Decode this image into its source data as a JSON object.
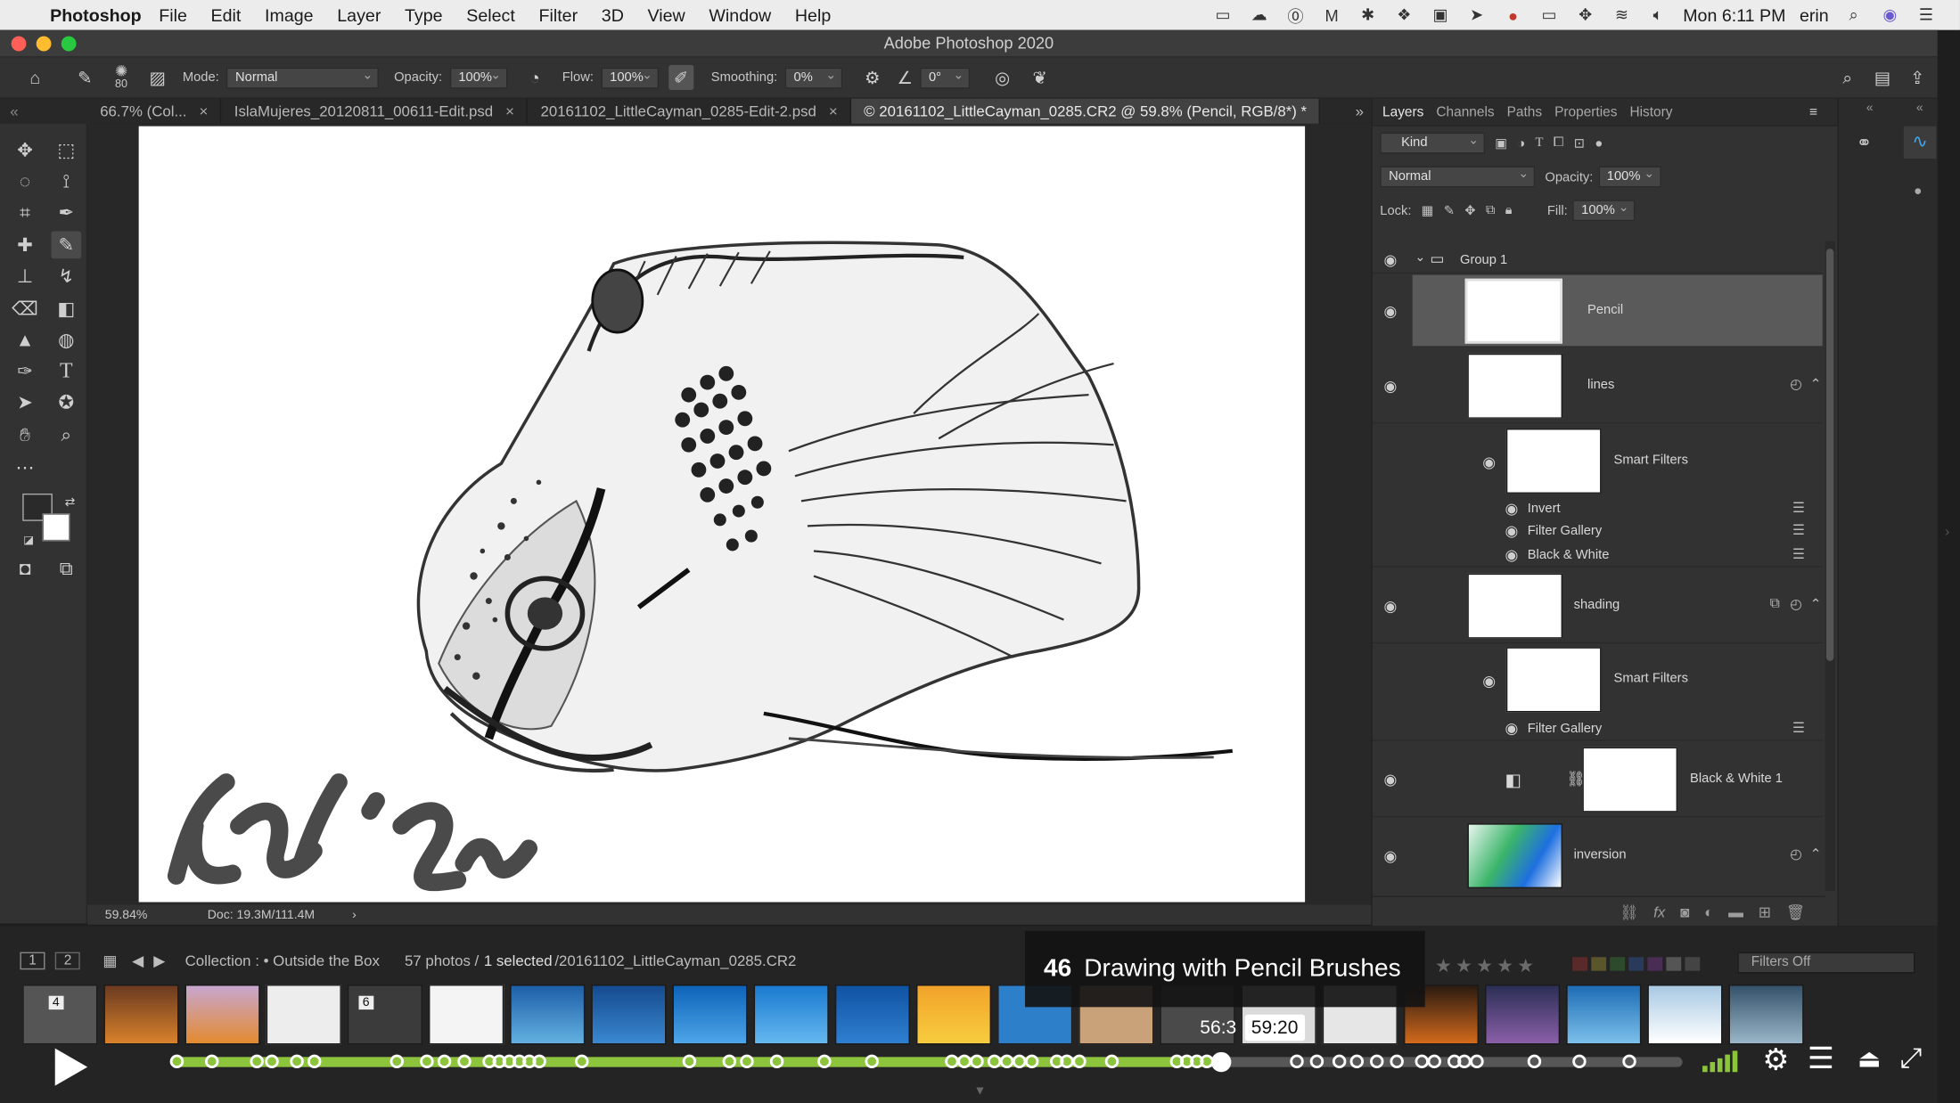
{
  "menubar": {
    "app_name": "Photoshop",
    "items": [
      "File",
      "Edit",
      "Image",
      "Layer",
      "Type",
      "Select",
      "Filter",
      "3D",
      "View",
      "Window",
      "Help"
    ],
    "clock": "Mon 6:11 PM",
    "user": "erin"
  },
  "window": {
    "title": "Adobe Photoshop 2020"
  },
  "options_bar": {
    "brush_size": "80",
    "mode_label": "Mode:",
    "mode_value": "Normal",
    "opacity_label": "Opacity:",
    "opacity_value": "100%",
    "flow_label": "Flow:",
    "flow_value": "100%",
    "smoothing_label": "Smoothing:",
    "smoothing_value": "0%",
    "angle_value": "0°"
  },
  "doc_tabs": [
    {
      "label": "66.7% (Col...",
      "active": false
    },
    {
      "label": "IslaMujeres_20120811_00611-Edit.psd",
      "active": false
    },
    {
      "label": "20161102_LittleCayman_0285-Edit-2.psd",
      "active": false
    },
    {
      "label": "© 20161102_LittleCayman_0285.CR2 @ 59.8% (Pencil, RGB/8*) *",
      "active": true
    }
  ],
  "status": {
    "zoom": "59.84%",
    "doc": "Doc: 19.3M/111.4M"
  },
  "panels": {
    "tabs": [
      "Layers",
      "Channels",
      "Paths",
      "Properties",
      "History"
    ],
    "kind_filter": "Kind",
    "blend_mode": "Normal",
    "opacity_label": "Opacity:",
    "opacity_value": "100%",
    "lock_label": "Lock:",
    "fill_label": "Fill:",
    "fill_value": "100%"
  },
  "layers": {
    "group": "Group 1",
    "pencil": "Pencil",
    "lines": "lines",
    "smart_filters_1": "Smart Filters",
    "invert": "Invert",
    "filter_gallery_1": "Filter Gallery",
    "black_white": "Black & White",
    "shading": "shading",
    "smart_filters_2": "Smart Filters",
    "filter_gallery_2": "Filter Gallery",
    "bw_adjust": "Black & White 1",
    "inversion": "inversion"
  },
  "lightroom": {
    "page1": "1",
    "page2": "2",
    "collection": "Collection : • Outside the Box",
    "photos": "57 photos /",
    "selected": "1 selected",
    "filename": "/20161102_LittleCayman_0285.CR2",
    "filters": "Filters Off",
    "thumb_numbers": [
      "4",
      "6"
    ]
  },
  "video": {
    "chapter_number": "46",
    "chapter_title": "Drawing with Pencil Brushes",
    "current_time": "56:3",
    "hover_time": "59:20",
    "played_fraction": 0.695,
    "accent_color": "#8cc43c"
  }
}
